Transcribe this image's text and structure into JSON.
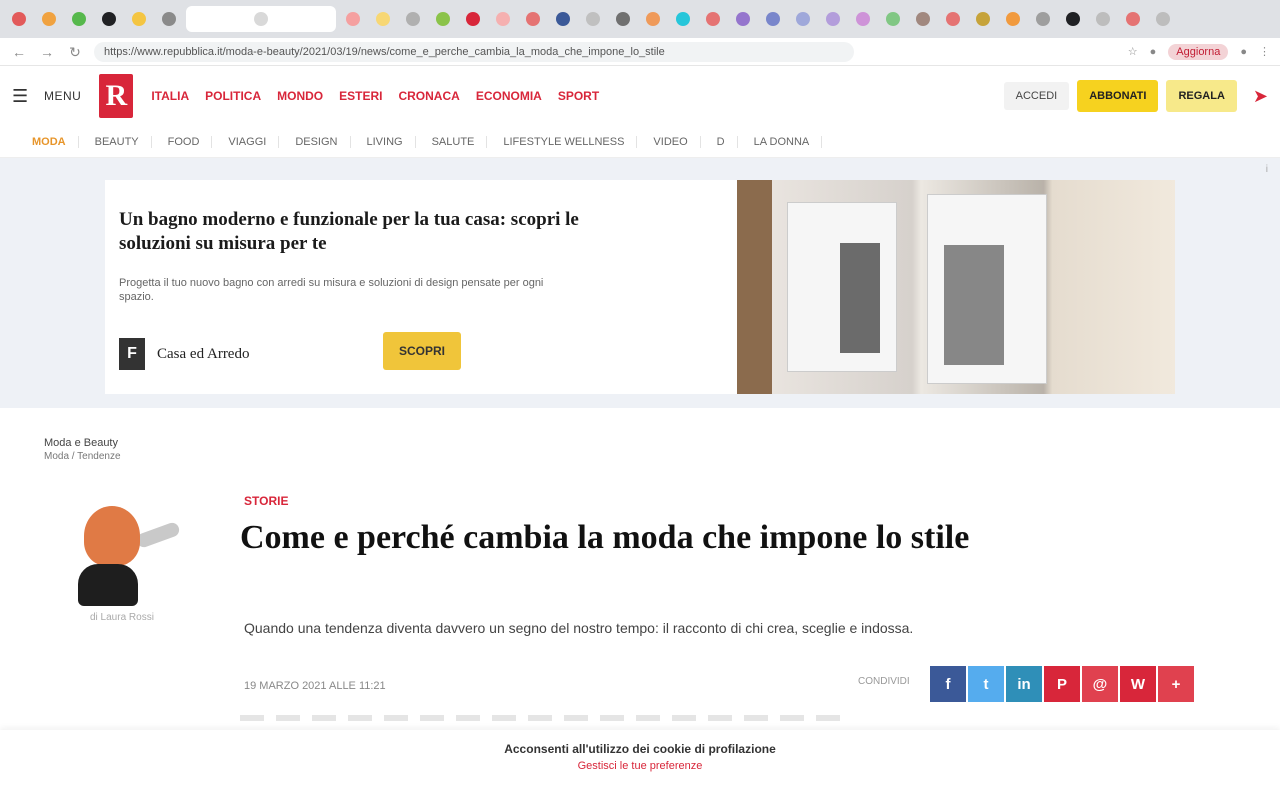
{
  "browser": {
    "tab_colors": [
      "#e25a5a",
      "#f0a240",
      "#56b84c",
      "#202124",
      "#f4c542",
      "#8a8a8a",
      "#d9d9d9",
      "#f5a0a0",
      "#f7d774",
      "#b0b0b0",
      "#8bc34a",
      "#d8263a",
      "#f5b0b0",
      "#e57373",
      "#3b5998",
      "#c0c0c0",
      "#707070",
      "#ef9a5a",
      "#26c6da",
      "#e57373",
      "#9575cd",
      "#7986cb",
      "#9fa8da",
      "#b39ddb",
      "#ce93d8",
      "#81c784",
      "#a1887f",
      "#e57373",
      "#c6a33a",
      "#f19a3e",
      "#9e9e9e",
      "#202124",
      "#bdbdbd",
      "#e57373",
      "#bdbdbd"
    ],
    "url": "https://www.repubblica.it/moda-e-beauty/2021/03/19/news/come_e_perche_cambia_la_moda_che_impone_lo_stile",
    "extension_label": "Aggiorna"
  },
  "header": {
    "menu_label": "MENU",
    "logo_letter": "R",
    "nav": [
      "ITALIA",
      "POLITICA",
      "MONDO",
      "ESTERI",
      "CRONACA",
      "ECONOMIA",
      "SPORT"
    ],
    "login_label": "ACCEDI",
    "subscribe_label": "ABBONATI",
    "subscribe2_label": "REGALA"
  },
  "subnav": {
    "items": [
      "MODA",
      "BEAUTY",
      "FOOD",
      "VIAGGI",
      "DESIGN",
      "LIVING",
      "SALUTE",
      "LIFESTYLE WELLNESS",
      "VIDEO",
      "D",
      "LA DONNA"
    ],
    "active_index": 0
  },
  "ad": {
    "corner": "i",
    "title": "Un bagno moderno e funzionale per la tua casa: scopri le soluzioni su misura per te",
    "description": "Progetta il tuo nuovo bagno con arredi su misura e soluzioni di design pensate per ogni spazio.",
    "brand_letter": "F",
    "brand_name": "Casa ed Arredo",
    "cta": "SCOPRI"
  },
  "article": {
    "breadcrumb": "Moda e Beauty",
    "breadcrumb_sub": "Moda / Tendenze",
    "author_caption": "di Laura Rossi",
    "kicker": "STORIE",
    "headline": "Come e perché cambia la moda che impone lo stile",
    "lead": "Quando una tendenza diventa davvero un segno del nostro tempo: il racconto di chi crea, sceglie e indossa.",
    "date": "19 MARZO 2021 ALLE 11:21",
    "share_label": "CONDIVIDI",
    "share": [
      {
        "icon": "facebook-icon",
        "glyph": "f",
        "color": "#3b5998"
      },
      {
        "icon": "twitter-icon",
        "glyph": "t",
        "color": "#55acee"
      },
      {
        "icon": "linkedin-icon",
        "glyph": "in",
        "color": "#2f8fb8"
      },
      {
        "icon": "pinterest-icon",
        "glyph": "P",
        "color": "#d8263a"
      },
      {
        "icon": "email-icon",
        "glyph": "@",
        "color": "#e0414f"
      },
      {
        "icon": "whatsapp-icon",
        "glyph": "W",
        "color": "#d8263a"
      },
      {
        "icon": "more-icon",
        "glyph": "+",
        "color": "#e0414f"
      }
    ]
  },
  "consent": {
    "line1": "Acconsenti all'utilizzo dei cookie di profilazione",
    "line2": "Gestisci le tue preferenze"
  }
}
